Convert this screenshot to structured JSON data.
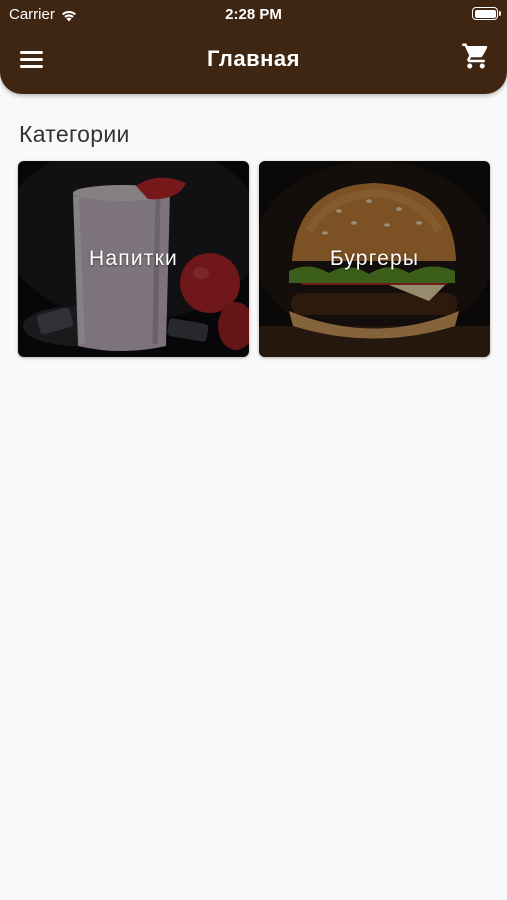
{
  "status_bar": {
    "carrier": "Carrier",
    "time": "2:28 PM"
  },
  "app_bar": {
    "title": "Главная",
    "menu_icon": "hamburger-menu-icon",
    "cart_icon": "shopping-cart-icon",
    "background_color": "#3f2613"
  },
  "categories": {
    "title": "Категории",
    "items": [
      {
        "label": "Напитки",
        "image": "milkshake-with-strawberries"
      },
      {
        "label": "Бургеры",
        "image": "burger"
      }
    ]
  }
}
